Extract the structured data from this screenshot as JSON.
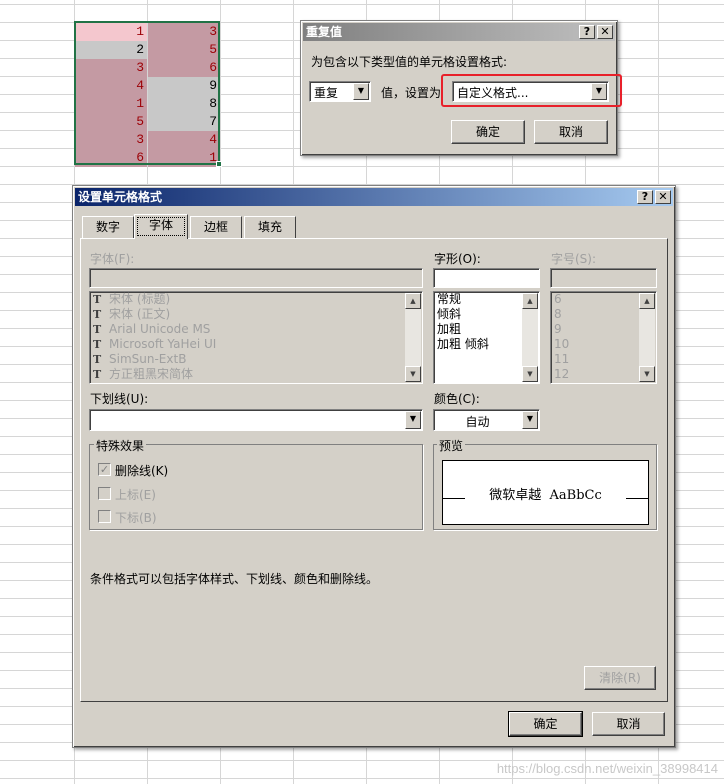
{
  "sheet": {
    "col_a": [
      {
        "value": "1",
        "style": "dupA"
      },
      {
        "value": "2",
        "style": "uniq"
      },
      {
        "value": "3",
        "style": "dup"
      },
      {
        "value": "4",
        "style": "dup"
      },
      {
        "value": "1",
        "style": "dup"
      },
      {
        "value": "5",
        "style": "dup"
      },
      {
        "value": "3",
        "style": "dup"
      },
      {
        "value": "6",
        "style": "dup"
      }
    ],
    "col_b": [
      {
        "value": "3",
        "style": "dup"
      },
      {
        "value": "5",
        "style": "dup"
      },
      {
        "value": "6",
        "style": "dup"
      },
      {
        "value": "9",
        "style": "uniq"
      },
      {
        "value": "8",
        "style": "uniq"
      },
      {
        "value": "7",
        "style": "uniq"
      },
      {
        "value": "4",
        "style": "dup"
      },
      {
        "value": "1",
        "style": "dup"
      }
    ]
  },
  "duplicate_dialog": {
    "title": "重复值",
    "prompt": "为包含以下类型值的单元格设置格式:",
    "type_value": "重复",
    "mid_label": "值，设置为",
    "format_value": "自定义格式...",
    "ok_label": "确定",
    "cancel_label": "取消",
    "help_label": "?",
    "close_label": "✕"
  },
  "format_dialog": {
    "title": "设置单元格格式",
    "help_label": "?",
    "close_label": "✕",
    "tabs": [
      "数字",
      "字体",
      "边框",
      "填充"
    ],
    "active_tab": 1,
    "font_label": "字体(F):",
    "font_list": [
      "宋体 (标题)",
      "宋体 (正文)",
      "Arial Unicode MS",
      "Microsoft YaHei UI",
      "SimSun-ExtB",
      "方正粗黑宋简体"
    ],
    "style_label": "字形(O):",
    "style_list": [
      "常规",
      "倾斜",
      "加粗",
      "加粗 倾斜"
    ],
    "size_label": "字号(S):",
    "size_list": [
      "6",
      "8",
      "9",
      "10",
      "11",
      "12"
    ],
    "underline_label": "下划线(U):",
    "underline_value": "",
    "color_label": "颜色(C):",
    "color_value": "自动",
    "effects_title": "特殊效果",
    "strikethrough_label": "删除线(K)",
    "strikethrough_checked": true,
    "superscript_label": "上标(E)",
    "subscript_label": "下标(B)",
    "preview_title": "预览",
    "preview_text": "微软卓越  AaBbCc",
    "note": "条件格式可以包括字体样式、下划线、颜色和删除线。",
    "clear_label": "清除(R)",
    "ok_label": "确定",
    "cancel_label": "取消"
  },
  "icons": {
    "font_type_icon": "TrueType-T",
    "scroll_up_icon": "▲",
    "scroll_down_icon": "▼",
    "dropdown_icon": "▼",
    "checkmark_icon": "✓"
  },
  "watermark": "https://blog.csdn.net/weixin_38998414",
  "colors": {
    "duplicate_fill": "#c49aa3",
    "duplicate_text": "#9c0006",
    "unique_fill": "#c8c8c8",
    "highlight_border": "#e8202a",
    "selection_border": "#217346"
  }
}
